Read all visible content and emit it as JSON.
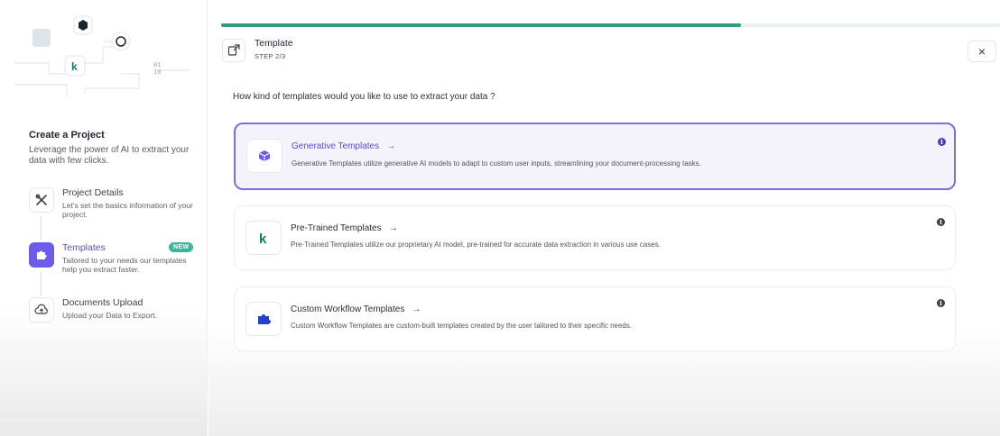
{
  "sidebar": {
    "title": "Create a Project",
    "description": "Leverage the power of AI to extract your data with few clicks.",
    "illustration_text": "01\n10",
    "steps": [
      {
        "label": "Project Details",
        "description": "Let's set the basics information of your project.",
        "icon": "tools-icon"
      },
      {
        "label": "Templates",
        "description": "Tailored to your needs our templates help you extract faster.",
        "icon": "puzzle-icon",
        "badge": "NEW",
        "active": true
      },
      {
        "label": "Documents Upload",
        "description": "Upload your Data to Export.",
        "icon": "cloud-upload-icon"
      }
    ]
  },
  "header": {
    "title": "Template",
    "step": "STEP 2/3",
    "progress_fraction": 0.667,
    "close_label": "×"
  },
  "question": "How kind of templates would you like to use to extract your data ?",
  "cards": [
    {
      "title": "Generative Templates",
      "arrow": "→",
      "description": "Generative Templates utilize generative AI models to adapt to custom user inputs, streamlining your document-processing tasks.",
      "icon": "cube-icon",
      "selected": true
    },
    {
      "title": "Pre-Trained Templates",
      "arrow": "→",
      "description": "Pre-Trained Templates utilize our proprietary AI model, pre-trained for accurate data extraction in various use cases.",
      "icon": "k-logo-icon"
    },
    {
      "title": "Custom Workflow Templates",
      "arrow": "→",
      "description": "Custom Workflow Templates are custom-built templates created by the user tailored to their specific needs.",
      "icon": "puzzle-icon"
    }
  ],
  "colors": {
    "accent": "#6c5ce7",
    "progress": "#2d9c83",
    "badge": "#3bb89a"
  }
}
